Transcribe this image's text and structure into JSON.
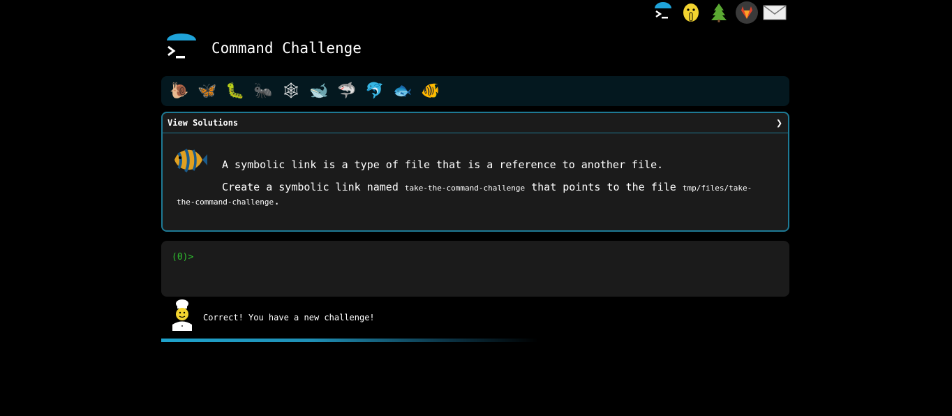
{
  "topbar": {
    "icons": [
      {
        "name": "cmd-logo-icon"
      },
      {
        "name": "shush-emoji-icon"
      },
      {
        "name": "tree-icon"
      },
      {
        "name": "gitlab-icon"
      },
      {
        "name": "mail-icon"
      }
    ]
  },
  "header": {
    "title": "Command Challenge"
  },
  "levels": {
    "items": [
      {
        "name": "snail-icon",
        "glyph": "🐌"
      },
      {
        "name": "butterfly-icon",
        "glyph": "🦋"
      },
      {
        "name": "caterpillar-icon",
        "glyph": "🐛"
      },
      {
        "name": "ant-icon",
        "glyph": "🐜"
      },
      {
        "name": "web-icon",
        "glyph": "🕸"
      },
      {
        "name": "whale-icon",
        "glyph": "🐋"
      },
      {
        "name": "shark-icon",
        "glyph": "🦈"
      },
      {
        "name": "dolphin-icon",
        "glyph": "🐬"
      },
      {
        "name": "fish-icon",
        "glyph": "🐟"
      },
      {
        "name": "tropical-fish-icon",
        "glyph": "🐠"
      }
    ]
  },
  "challenge": {
    "view_solutions": "View Solutions",
    "chevron": "❯",
    "line1": "A symbolic link is a type of file that is a reference to another file.",
    "line2_a": "Create a symbolic link named ",
    "line2_code1": "take-the-command-challenge",
    "line2_b": " that points to the file ",
    "line2_code2": "tmp/files/take-the-command-challenge",
    "line2_c": "."
  },
  "terminal": {
    "prompt": "(0)>"
  },
  "status": {
    "message": "Correct! You have a new challenge!",
    "progress": 0.6
  }
}
